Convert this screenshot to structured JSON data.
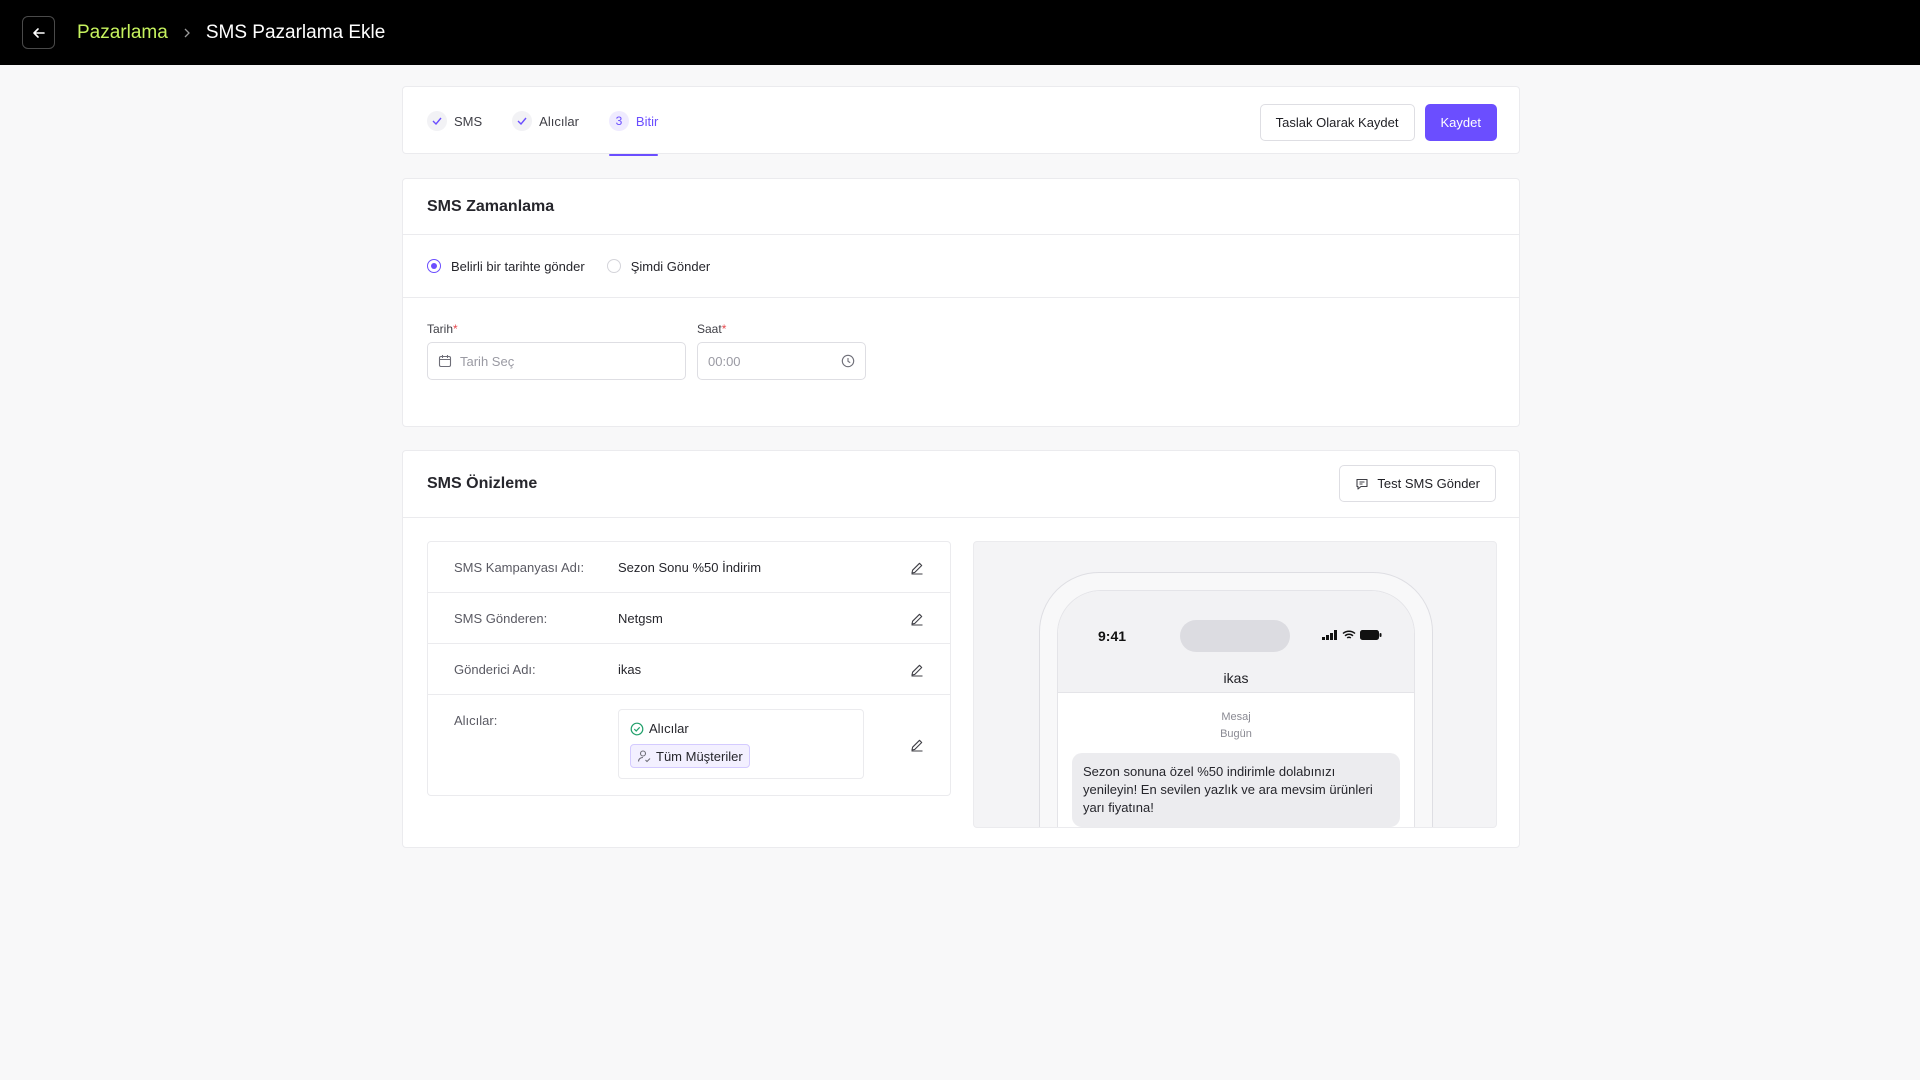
{
  "header": {
    "back_icon": "arrow-left-icon",
    "breadcrumb_parent": "Pazarlama",
    "breadcrumb_current": "SMS Pazarlama Ekle"
  },
  "stepper": {
    "steps": [
      {
        "label": "SMS",
        "marker": "✓",
        "state": "done"
      },
      {
        "label": "Alıcılar",
        "marker": "✓",
        "state": "done"
      },
      {
        "label": "Bitir",
        "marker": "3",
        "state": "active"
      }
    ],
    "draft_button": "Taslak Olarak Kaydet",
    "save_button": "Kaydet"
  },
  "schedule": {
    "title": "SMS Zamanlama",
    "options": [
      {
        "label": "Belirli bir tarihte gönder",
        "selected": true
      },
      {
        "label": "Şimdi Gönder",
        "selected": false
      }
    ],
    "date_label": "Tarih",
    "date_placeholder": "Tarih Seç",
    "time_label": "Saat",
    "time_value": "00:00",
    "required_mark": "*"
  },
  "preview": {
    "title": "SMS Önizleme",
    "test_button": "Test SMS Gönder",
    "rows": [
      {
        "label": "SMS Kampanyası Adı:",
        "value": "Sezon Sonu %50 İndirim"
      },
      {
        "label": "SMS Gönderen:",
        "value": "Netgsm"
      },
      {
        "label": "Gönderici Adı:",
        "value": "ikas"
      }
    ],
    "recipients_label": "Alıcılar:",
    "recipients_box_title": "Alıcılar",
    "recipients_tag": "Tüm Müşteriler",
    "phone": {
      "time": "9:41",
      "sender": "ikas",
      "meta_line1": "Mesaj",
      "meta_line2": "Bugün",
      "message": "Sezon sonuna özel %50 indirimle dolabınızı yenileyin! En sevilen yazlık ve ara mevsim ürünleri yarı fiyatına!"
    }
  },
  "colors": {
    "accent": "#6b4eff",
    "breadcrumb_parent": "#c6f25e",
    "topbar": "#000000",
    "success": "#22a06b"
  }
}
